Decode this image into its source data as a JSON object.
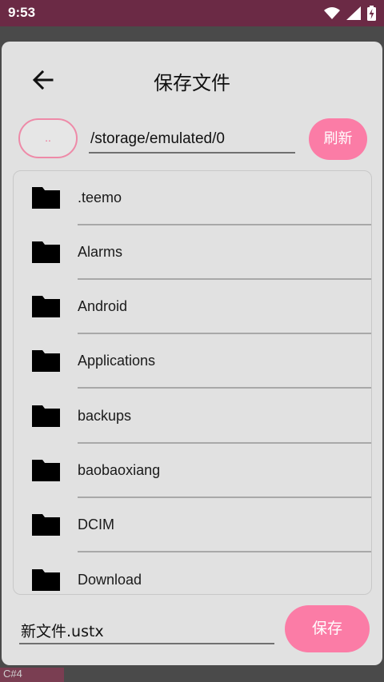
{
  "status_bar": {
    "time": "9:53",
    "icons": [
      "wifi-icon",
      "signal-icon",
      "battery-charging-icon"
    ]
  },
  "dialog": {
    "title": "保存文件",
    "up_button_label": "..",
    "path_value": "/storage/emulated/0",
    "refresh_label": "刷新",
    "folders": [
      {
        "name": ".teemo",
        "icon": "folder-icon"
      },
      {
        "name": "Alarms",
        "icon": "folder-icon"
      },
      {
        "name": "Android",
        "icon": "folder-icon"
      },
      {
        "name": "Applications",
        "icon": "folder-icon"
      },
      {
        "name": "backups",
        "icon": "folder-icon"
      },
      {
        "name": "baobaoxiang",
        "icon": "folder-icon"
      },
      {
        "name": "DCIM",
        "icon": "folder-icon"
      },
      {
        "name": "Download",
        "icon": "folder-icon"
      }
    ],
    "filename_value": "新文件.ustx",
    "save_label": "保存"
  },
  "backdrop": {
    "tag": "C#4"
  },
  "colors": {
    "status_bar": "#6b2a45",
    "accent": "#fb7ca6",
    "dialog_bg": "#e1e1e1"
  }
}
